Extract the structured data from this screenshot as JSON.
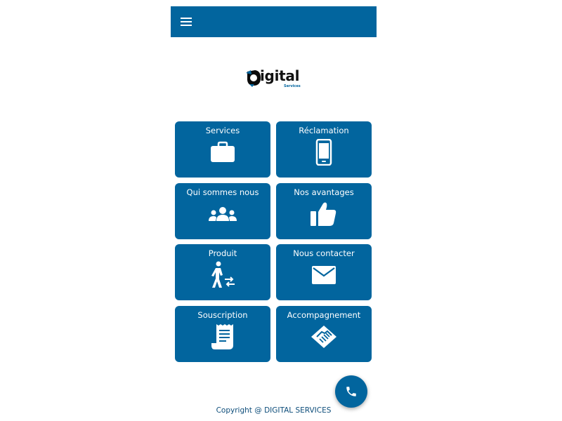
{
  "appbar": {
    "menu_icon": "menu-icon",
    "color": "#02659e"
  },
  "logo": {
    "text": "igital",
    "subtext": "Services"
  },
  "tiles": [
    {
      "label": "Services",
      "icon": "briefcase-icon"
    },
    {
      "label": "Réclamation",
      "icon": "smartphone-icon"
    },
    {
      "label": "Qui sommes nous",
      "icon": "users-icon"
    },
    {
      "label": "Nos avantages",
      "icon": "thumbs-up-icon"
    },
    {
      "label": "Produit",
      "icon": "person-exchange-icon"
    },
    {
      "label": "Nous contacter",
      "icon": "envelope-icon"
    },
    {
      "label": "Souscription",
      "icon": "receipt-icon"
    },
    {
      "label": "Accompagnement",
      "icon": "handshake-icon"
    }
  ],
  "fab": {
    "icon": "phone-icon"
  },
  "footer": {
    "text": "Copyright @ DIGITAL SERVICES"
  },
  "colors": {
    "primary": "#02659e",
    "background": "#ffffff",
    "footer_text": "#0d4d7a"
  }
}
